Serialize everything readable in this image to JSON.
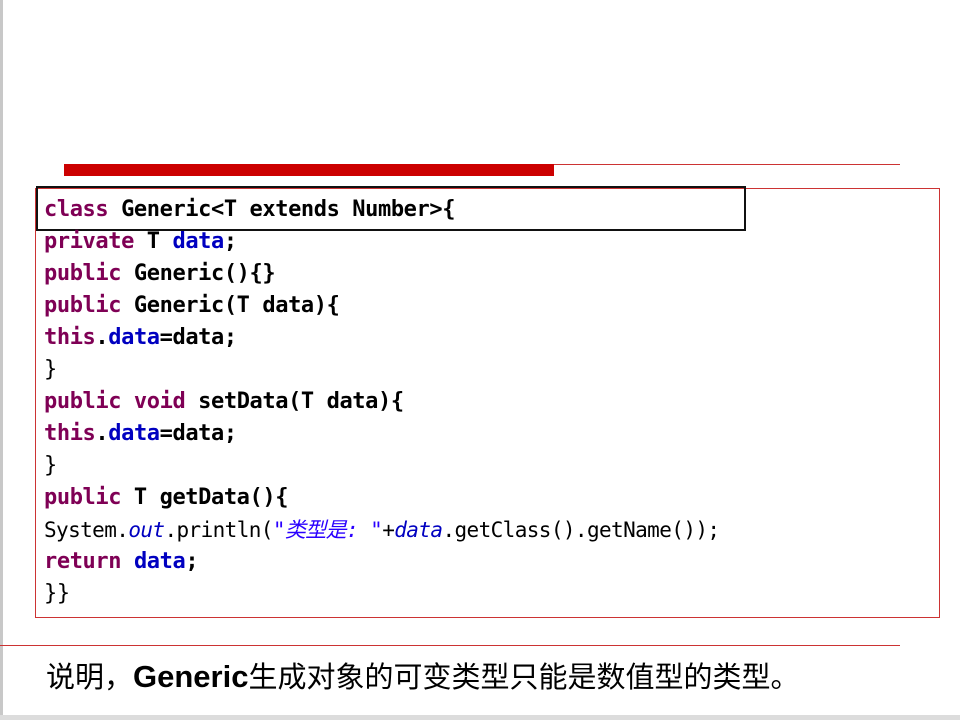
{
  "code": {
    "line1": {
      "kw": "class",
      "rest": " Generic<T extends Number>{"
    },
    "line2": {
      "kw": "private",
      "type": " T ",
      "field": "data",
      "end": ";"
    },
    "line3": {
      "kw": "public",
      "rest": " Generic(){}"
    },
    "line4": {
      "kw": "public",
      "rest": " Generic(T data){"
    },
    "line5": {
      "kw": "this",
      "dot": ".",
      "field": "data",
      "rest": "=data;"
    },
    "line6": {
      "brace": "}"
    },
    "line7": {
      "kw": "public",
      "kw2": " void",
      "rest": " setData(T data){"
    },
    "line8": {
      "kw": "this",
      "dot": ".",
      "field": "data",
      "rest": "=data;"
    },
    "line9": {
      "brace": "}"
    },
    "line10": {
      "kw": "public",
      "rest": " T getData(){"
    },
    "line11": {
      "sys": "System.",
      "out": "out",
      "println": ".println(",
      "str": "\"类型是: \"",
      "plus": "+",
      "data": "data",
      "tail": ".getClass().getName());"
    },
    "line12": {
      "kw": "return",
      "sp": " ",
      "field": "data",
      "end": ";"
    },
    "line13": {
      "brace": "}}"
    }
  },
  "note": {
    "prefix": "说明，",
    "term": "Generic",
    "suffix": "生成对象的可变类型只能是数值型的类型。"
  },
  "colors": {
    "accent": "#cc0000",
    "keyword": "#7f0055",
    "field": "#0000c0",
    "string": "#2a00ff"
  }
}
